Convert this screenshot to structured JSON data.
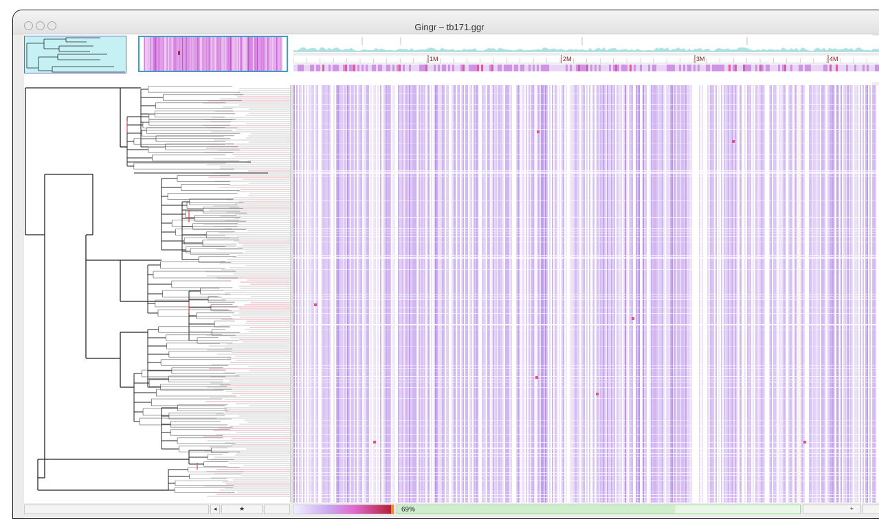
{
  "window": {
    "title": "Gingr – tb171.ggr"
  },
  "colors": {
    "matrix": "#c9a9f0",
    "matrix_dark": "#b38ae6",
    "highlight": "#e94d87",
    "coverage": "#8fd4d4",
    "tree_bg_mini": "#c6f1f4",
    "progress": "#cfeecb"
  },
  "overview": {
    "ticks": [
      "1M",
      "2M",
      "3M",
      "4M"
    ]
  },
  "statusbar": {
    "progress_value": 0.69,
    "progress_label": "69%",
    "left_arrow_icon": "left-arrow-icon",
    "star_icon": "star-icon",
    "plus_label": "+"
  }
}
